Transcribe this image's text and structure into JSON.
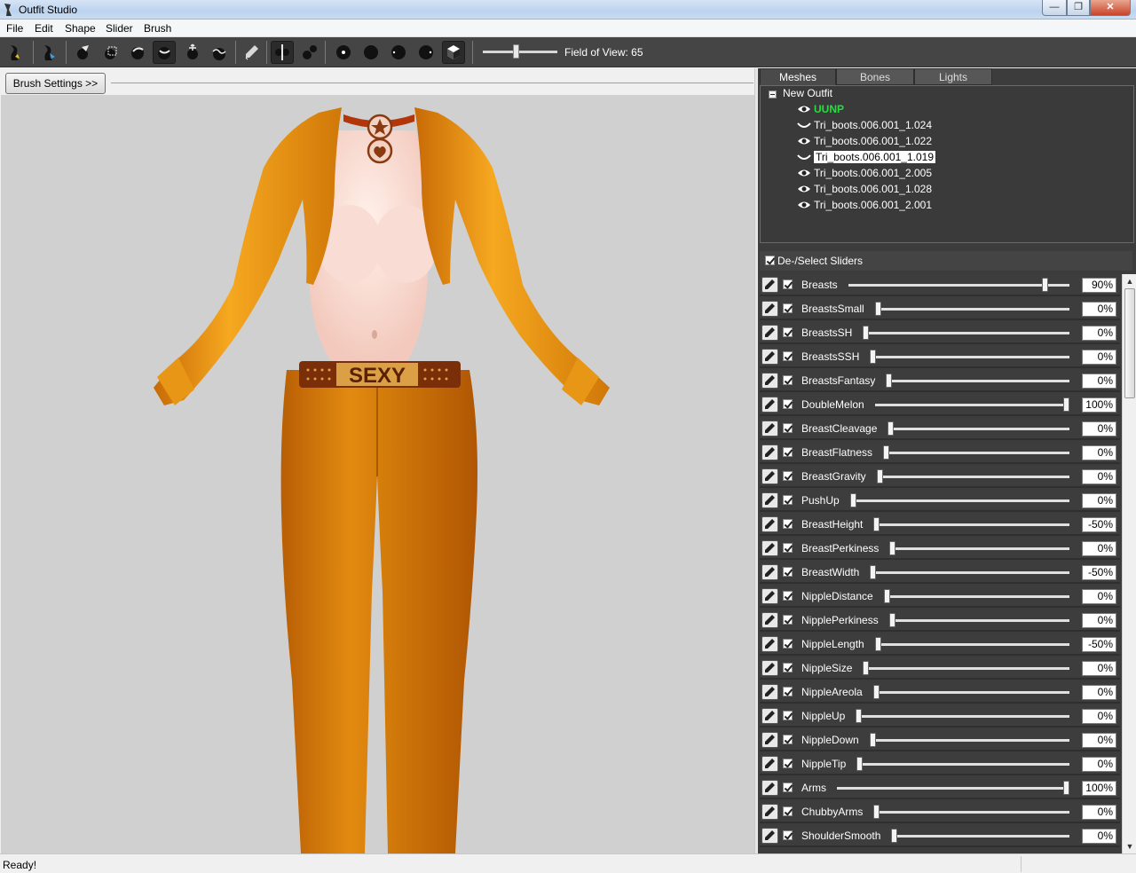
{
  "window": {
    "title": "Outfit Studio",
    "minimize_icon": "minimize-icon",
    "maximize_icon": "maximize-icon",
    "close_icon": "close-icon"
  },
  "menu": [
    "File",
    "Edit",
    "Shape",
    "Slider",
    "Brush"
  ],
  "toolbar": {
    "tools": [
      "inflate-brush-icon",
      "move-brush-icon",
      "select-icon",
      "mask-icon",
      "inflate-icon",
      "deflate-icon",
      "move-icon",
      "smooth-icon",
      "weight-icon",
      "x-mirror-icon",
      "connected-only-icon",
      "point-light-icon",
      "flat-light-icon",
      "half-light-icon",
      "full-light-icon",
      "cube-icon"
    ],
    "fov_label": "Field of View: 65"
  },
  "brush_settings": {
    "label": "Brush Settings >>"
  },
  "tabs": [
    "Meshes",
    "Bones",
    "Lights"
  ],
  "mesh_tree": {
    "root": "New Outfit",
    "items": [
      {
        "label": "UUNP",
        "visibility": "eye",
        "highlight": "#21e03d"
      },
      {
        "label": "Tri_boots.006.001_1.024",
        "visibility": "closed"
      },
      {
        "label": "Tri_boots.006.001_1.022",
        "visibility": "eye"
      },
      {
        "label": "Tri_boots.006.001_1.019",
        "visibility": "closed",
        "selected": true
      },
      {
        "label": "Tri_boots.006.001_2.005",
        "visibility": "eye"
      },
      {
        "label": "Tri_boots.006.001_1.028",
        "visibility": "eye"
      },
      {
        "label": "Tri_boots.006.001_2.001",
        "visibility": "eye"
      }
    ]
  },
  "sliders": {
    "header": "De-/Select Sliders",
    "items": [
      {
        "name": "Breasts",
        "value": "90%",
        "pos": 0.9
      },
      {
        "name": "BreastsSmall",
        "value": "0%",
        "pos": 0.0
      },
      {
        "name": "BreastsSH",
        "value": "0%",
        "pos": 0.0
      },
      {
        "name": "BreastsSSH",
        "value": "0%",
        "pos": 0.0
      },
      {
        "name": "BreastsFantasy",
        "value": "0%",
        "pos": 0.0
      },
      {
        "name": "DoubleMelon",
        "value": "100%",
        "pos": 1.0
      },
      {
        "name": "BreastCleavage",
        "value": "0%",
        "pos": 0.0
      },
      {
        "name": "BreastFlatness",
        "value": "0%",
        "pos": 0.0
      },
      {
        "name": "BreastGravity",
        "value": "0%",
        "pos": 0.0
      },
      {
        "name": "PushUp",
        "value": "0%",
        "pos": 0.0
      },
      {
        "name": "BreastHeight",
        "value": "-50%",
        "pos": 0.0
      },
      {
        "name": "BreastPerkiness",
        "value": "0%",
        "pos": 0.0
      },
      {
        "name": "BreastWidth",
        "value": "-50%",
        "pos": 0.0
      },
      {
        "name": "NippleDistance",
        "value": "0%",
        "pos": 0.0
      },
      {
        "name": "NipplePerkiness",
        "value": "0%",
        "pos": 0.0
      },
      {
        "name": "NippleLength",
        "value": "-50%",
        "pos": 0.0
      },
      {
        "name": "NippleSize",
        "value": "0%",
        "pos": 0.0
      },
      {
        "name": "NippleAreola",
        "value": "0%",
        "pos": 0.0
      },
      {
        "name": "NippleUp",
        "value": "0%",
        "pos": 0.0
      },
      {
        "name": "NippleDown",
        "value": "0%",
        "pos": 0.0
      },
      {
        "name": "NippleTip",
        "value": "0%",
        "pos": 0.0
      },
      {
        "name": "Arms",
        "value": "100%",
        "pos": 1.0
      },
      {
        "name": "ChubbyArms",
        "value": "0%",
        "pos": 0.0
      },
      {
        "name": "ShoulderSmooth",
        "value": "0%",
        "pos": 0.0
      }
    ]
  },
  "viewport": {
    "belt_text": "SEXY"
  },
  "status": {
    "text": "Ready!"
  },
  "colors": {
    "viewport_bg": "#d0d0d0",
    "outfit": "#e08a12",
    "panel": "#3c3c3c"
  }
}
